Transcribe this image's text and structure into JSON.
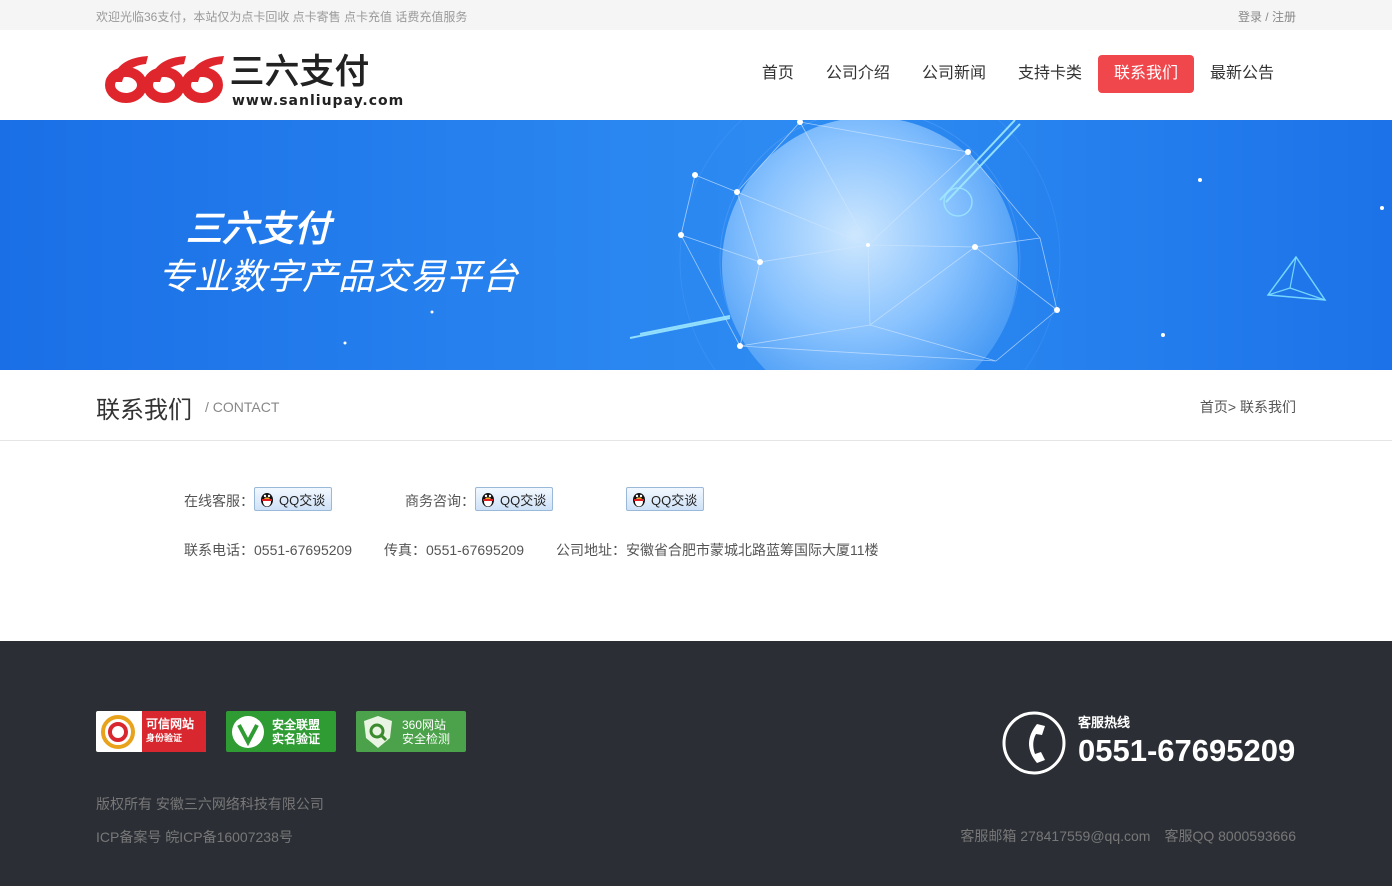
{
  "topbar": {
    "welcome": "欢迎光临36支付，本站仅为点卡回收 点卡寄售 点卡充值  话费充值服务",
    "login": "登录",
    "separator": " / ",
    "register": "注册"
  },
  "logo": {
    "digits": "666",
    "name": "三六支付",
    "url": "www.sanliupay.com"
  },
  "nav": {
    "items": [
      "首页",
      "公司介绍",
      "公司新闻",
      "支持卡类",
      "联系我们",
      "最新公告"
    ],
    "active": "联系我们"
  },
  "banner": {
    "title": "三六支付",
    "subtitle": "专业数字产品交易平台"
  },
  "page": {
    "title": "联系我们",
    "title_en": "/ CONTACT",
    "breadcrumb_home": "首页>",
    "breadcrumb_current": " 联系我们"
  },
  "contact": {
    "online_label": "在线客服：",
    "business_label": "商务咨询：",
    "qq_button": "QQ交谈",
    "phone": "联系电话：0551-67695209",
    "fax": "传真：0551-67695209",
    "address": "公司地址：安徽省合肥市蒙城北路蓝筹国际大厦11楼"
  },
  "footer": {
    "badges": [
      {
        "line1": "可信网站",
        "line2": "身份验证",
        "color": "#d8272f"
      },
      {
        "line1": "安全联盟",
        "line2": "实名验证",
        "color": "#2e9b33"
      },
      {
        "line1": "360网站",
        "line2": "安全检测",
        "color": "#4ba24a"
      }
    ],
    "copyright": "版权所有 安徽三六网络科技有限公司",
    "icp": "ICP备案号 皖ICP备16007238号",
    "hotline_label": "客服热线",
    "hotline_number": "0551-67695209",
    "email": "客服邮箱 278417559@qq.com",
    "qq": "客服QQ 8000593666"
  },
  "colors": {
    "accent": "#f0474d",
    "banner": "#1f78eb",
    "footer_bg": "#2b2f35",
    "logo_red": "#e0262d"
  }
}
